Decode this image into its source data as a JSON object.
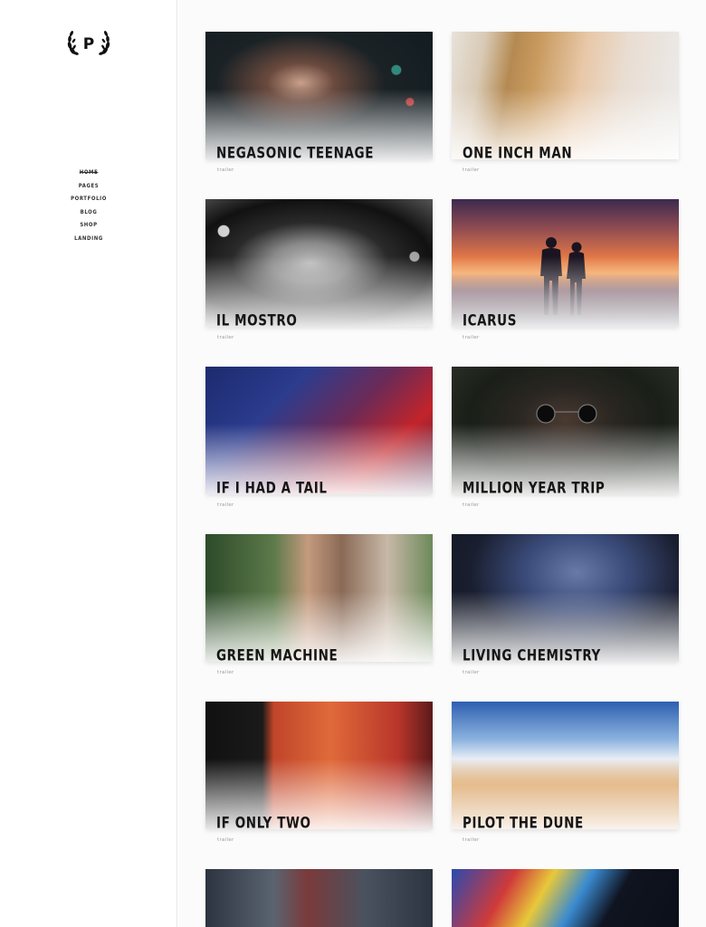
{
  "logo": {
    "letter": "P"
  },
  "nav": [
    "HOME",
    "PAGES",
    "PORTFOLIO",
    "BLOG",
    "SHOP",
    "LANDING"
  ],
  "portfolio": [
    {
      "title": "NEGASONIC TEENAGE",
      "category": "trailer"
    },
    {
      "title": "ONE INCH MAN",
      "category": "trailer"
    },
    {
      "title": "IL MOSTRO",
      "category": "trailer"
    },
    {
      "title": "ICARUS",
      "category": "trailer"
    },
    {
      "title": "IF I HAD A TAIL",
      "category": "trailer"
    },
    {
      "title": "MILLION YEAR TRIP",
      "category": "trailer"
    },
    {
      "title": "GREEN MACHINE",
      "category": "trailer"
    },
    {
      "title": "LIVING CHEMISTRY",
      "category": "trailer"
    },
    {
      "title": "IF ONLY TWO",
      "category": "trailer"
    },
    {
      "title": "PILOT THE DUNE",
      "category": "trailer"
    },
    {
      "title": "",
      "category": ""
    },
    {
      "title": "",
      "category": ""
    }
  ]
}
